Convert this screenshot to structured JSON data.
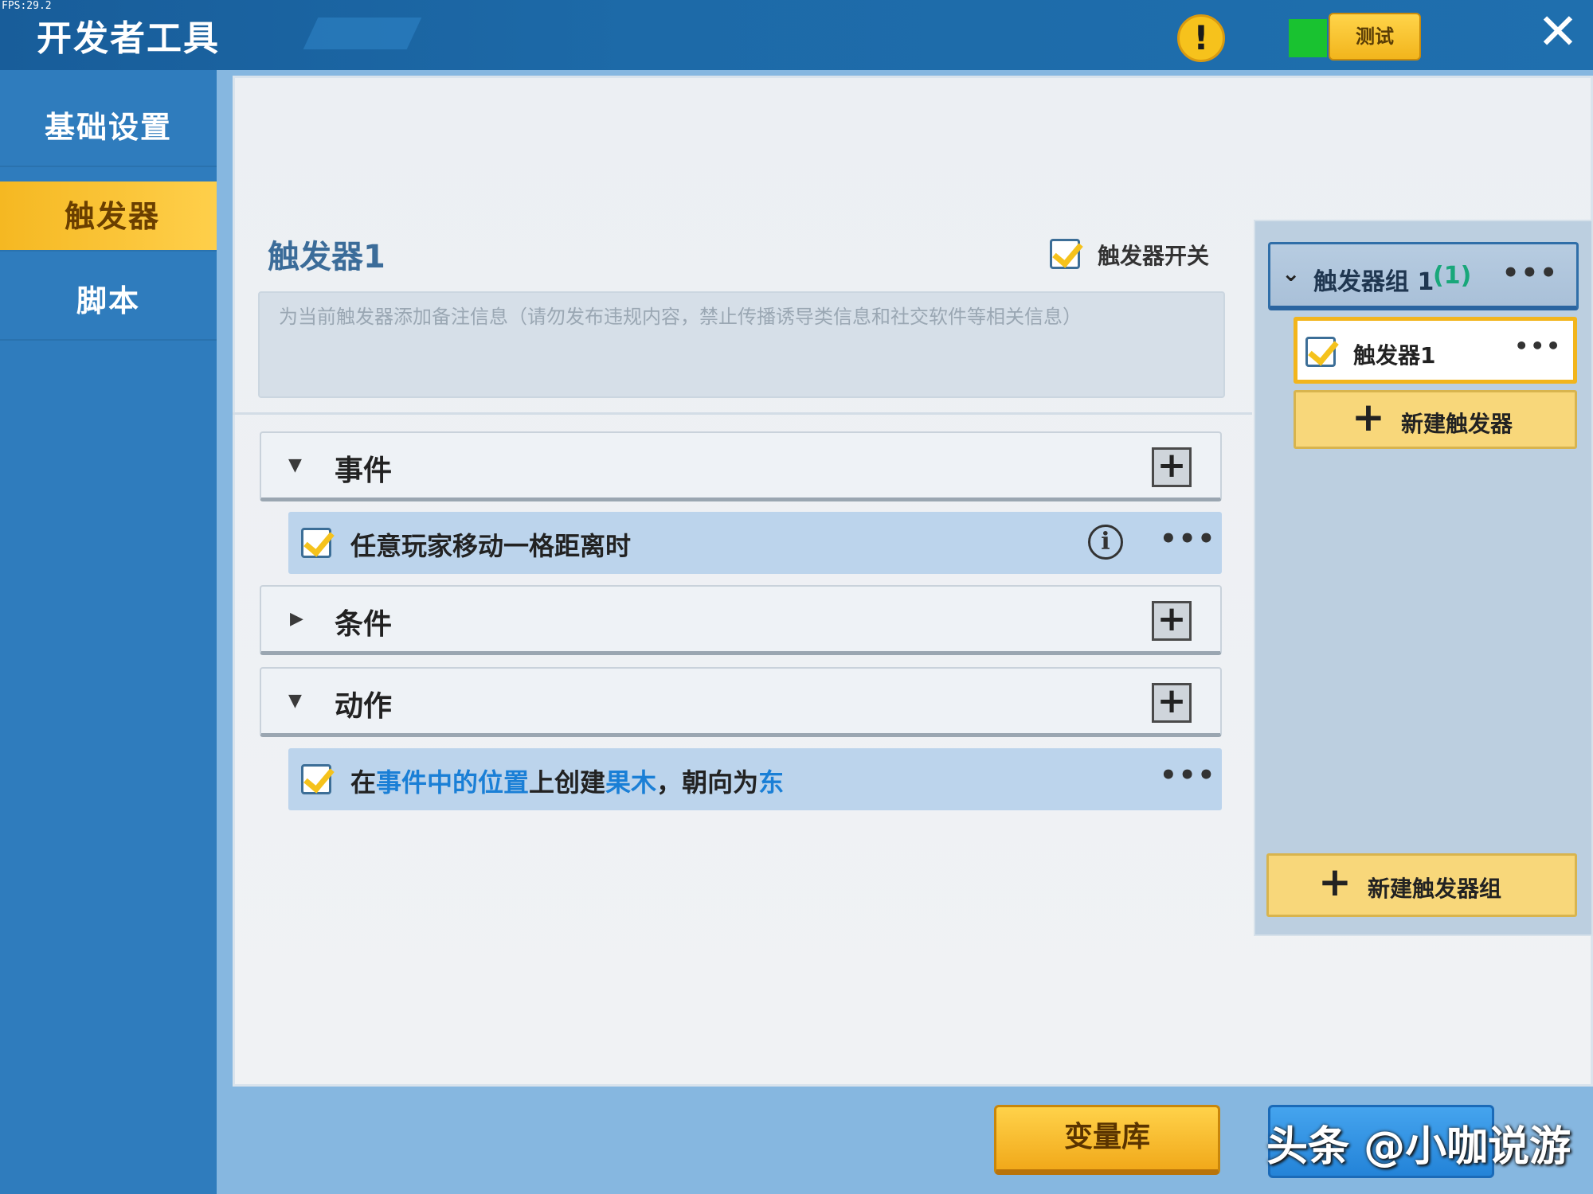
{
  "fps": "FPS:29.2",
  "header": {
    "title": "开发者工具",
    "warning_icon": "!",
    "test_label": "测试",
    "close_icon": "✕",
    "status_color": "#19c230"
  },
  "sidebar": {
    "items": [
      {
        "label": "基础设置",
        "active": false
      },
      {
        "label": "触发器",
        "active": true
      },
      {
        "label": "脚本",
        "active": false
      }
    ]
  },
  "editor": {
    "trigger_name": "触发器1",
    "switch_label": "触发器开关",
    "switch_checked": true,
    "note_placeholder": "为当前触发器添加备注信息（请勿发布违规内容，禁止传播诱导类信息和社交软件等相关信息）",
    "sections": {
      "event": {
        "label": "事件",
        "expanded": true
      },
      "condition": {
        "label": "条件",
        "expanded": false
      },
      "action": {
        "label": "动作",
        "expanded": true
      }
    },
    "event_item": {
      "text": "任意玩家移动一格距离时",
      "checked": true
    },
    "action_item": {
      "checked": true,
      "parts": [
        "在",
        "事件中的位置",
        "上创建",
        "果木",
        "，朝向为",
        "东"
      ]
    },
    "more_icon": "•••",
    "info_icon": "i",
    "plus_icon": "+"
  },
  "right_panel": {
    "group_name": "触发器组 1",
    "group_count": "(1)",
    "chevron_icon": "⌄",
    "trigger_item": {
      "name": "触发器1",
      "checked": true
    },
    "new_trigger_label": "新建触发器",
    "new_group_label": "新建触发器组"
  },
  "bottom": {
    "variable_lib_label": "变量库",
    "watermark": "头条 @小咖说游"
  },
  "colors": {
    "accent_yellow": "#f5b822",
    "highlight_blue": "#1a7fd6",
    "header_blue": "#1d6aa8",
    "count_green": "#19a77a"
  }
}
